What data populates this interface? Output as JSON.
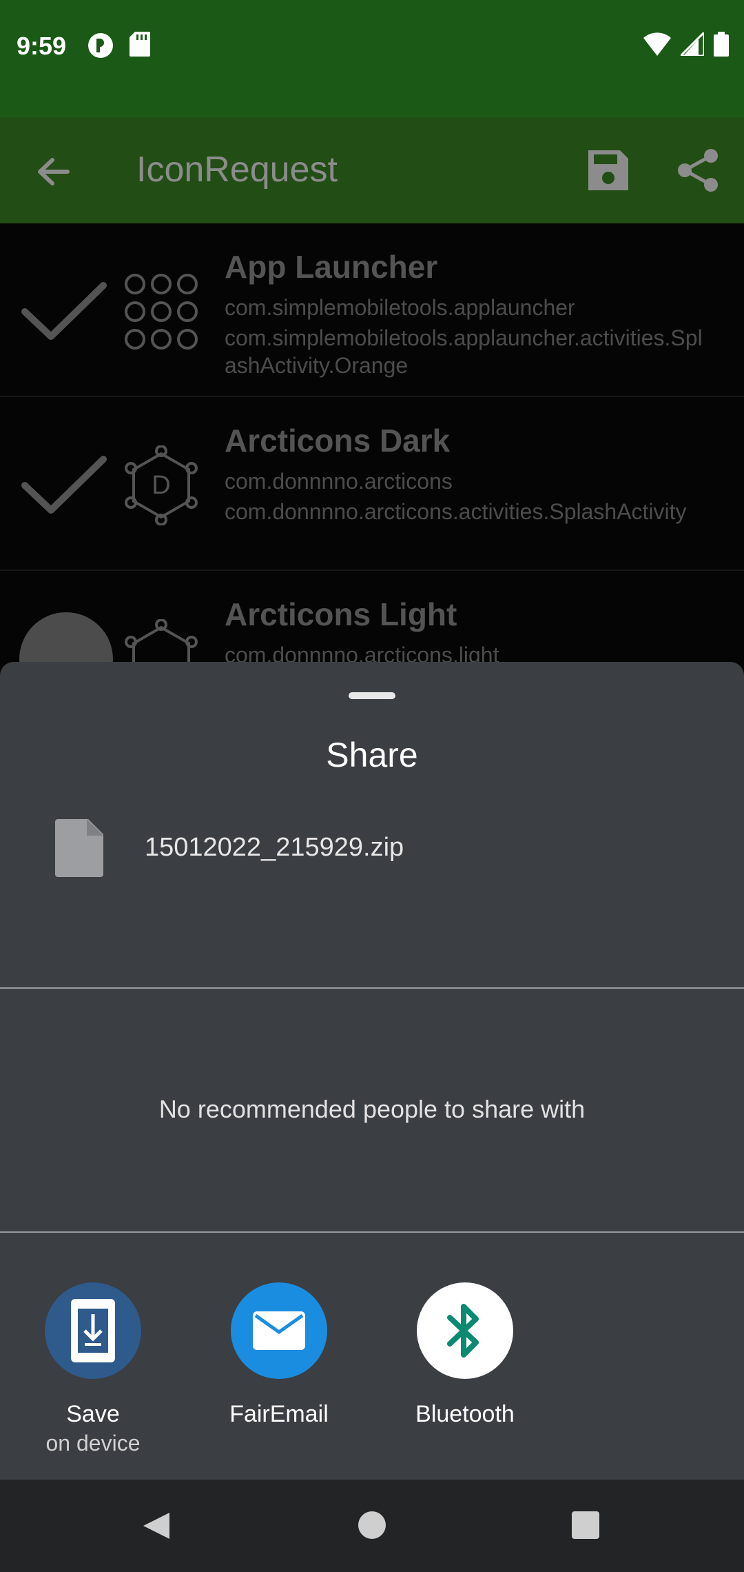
{
  "status_bar": {
    "time": "9:59",
    "left_icons": [
      "notification-app-icon",
      "sd-card-icon"
    ],
    "right_icons": [
      "wifi-icon",
      "cell-signal-icon",
      "battery-icon"
    ]
  },
  "toolbar": {
    "title": "IconRequest",
    "back_icon": "arrow-back-icon",
    "save_icon": "save-icon",
    "share_icon": "share-icon"
  },
  "apps": [
    {
      "name": "App Launcher",
      "package": "com.simplemobiletools.applauncher",
      "activity": "com.simplemobiletools.applauncher.activities.SplashActivity.Orange",
      "checked": true
    },
    {
      "name": "Arcticons Dark",
      "package": "com.donnnno.arcticons",
      "activity": "com.donnnno.arcticons.activities.SplashActivity",
      "checked": true
    },
    {
      "name": "Arcticons Light",
      "package": "com.donnnno.arcticons.light",
      "activity": "",
      "checked": false
    }
  ],
  "share_sheet": {
    "title": "Share",
    "file_name": "15012022_215929.zip",
    "no_people_text": "No recommended people to share with",
    "targets": [
      {
        "label": "Save",
        "sublabel": "on device",
        "icon": "save-to-device-icon",
        "color": "#2f5a8c"
      },
      {
        "label": "FairEmail",
        "sublabel": "",
        "icon": "email-icon",
        "color": "#1a8de0"
      },
      {
        "label": "Bluetooth",
        "sublabel": "",
        "icon": "bluetooth-icon",
        "color": "#ffffff"
      }
    ]
  },
  "nav_bar": {
    "back_icon": "nav-back-icon",
    "home_icon": "nav-home-icon",
    "recents_icon": "nav-recents-icon"
  }
}
